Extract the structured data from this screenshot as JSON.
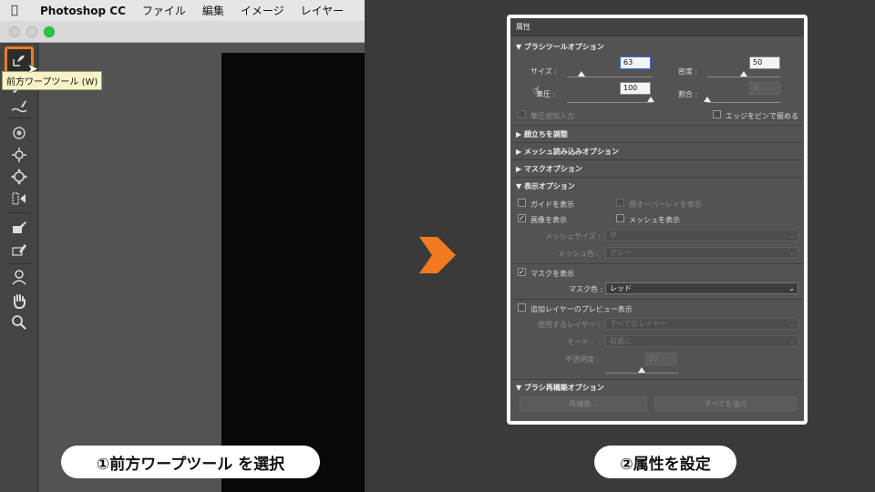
{
  "menubar": {
    "apple_icon": "apple-logo-icon",
    "app_name": "Photoshop CC",
    "items": [
      "ファイル",
      "編集",
      "イメージ",
      "レイヤー"
    ]
  },
  "tooltip": "前方ワープツール (W)",
  "captions": {
    "step1": "①前方ワープツール を選択",
    "step2": "②属性を設定"
  },
  "colors": {
    "accent_orange": "#f47a20",
    "panel_bg": "#535353",
    "canvas_black": "#080808"
  },
  "panel": {
    "title": "属性",
    "brush_tool_options": {
      "title": "ブラシツールオプション",
      "size_label": "サイズ :",
      "size_value": "63",
      "density_label": "密度 :",
      "density_value": "50",
      "pressure_label": "筆圧 :",
      "pressure_value": "100",
      "rate_label": "割合 :",
      "rate_value": "0",
      "stylus_pressure_label": "筆圧感知入力",
      "pin_edges_label": "エッジをピンで留める",
      "size_slider": 0.13,
      "density_slider": 0.5,
      "pressure_slider": 1.0,
      "rate_slider": 0.0
    },
    "collapsed_sections": [
      "顔立ちを調整",
      "メッシュ読み込みオプション",
      "マスクオプション"
    ],
    "view_options": {
      "title": "表示オプション",
      "show_guides": "ガイドを表示",
      "show_face_overlay": "顔オーバーレイを表示",
      "show_image": "画像を表示",
      "show_mesh": "メッシュを表示",
      "mesh_size_label": "メッシュサイズ :",
      "mesh_size_value": "中",
      "mesh_color_label": "メッシュ色 :",
      "mesh_color_value": "グレー",
      "show_mask": "マスクを表示",
      "mask_color_label": "マスク色 :",
      "mask_color_value": "レッド",
      "show_backdrop": "追加レイヤーのプレビュー表示",
      "use_layer_label": "使用するレイヤー :",
      "use_layer_value": "すべてのレイヤー",
      "mode_label": "モード :",
      "mode_value": "前面に",
      "opacity_label": "不透明度 :",
      "opacity_value": "50",
      "opacity_slider": 0.5
    },
    "brush_reconstruct": {
      "title": "ブラシ再構築オプション",
      "reconstruct_button": "再構築...",
      "restore_all_button": "すべてを復元"
    }
  }
}
